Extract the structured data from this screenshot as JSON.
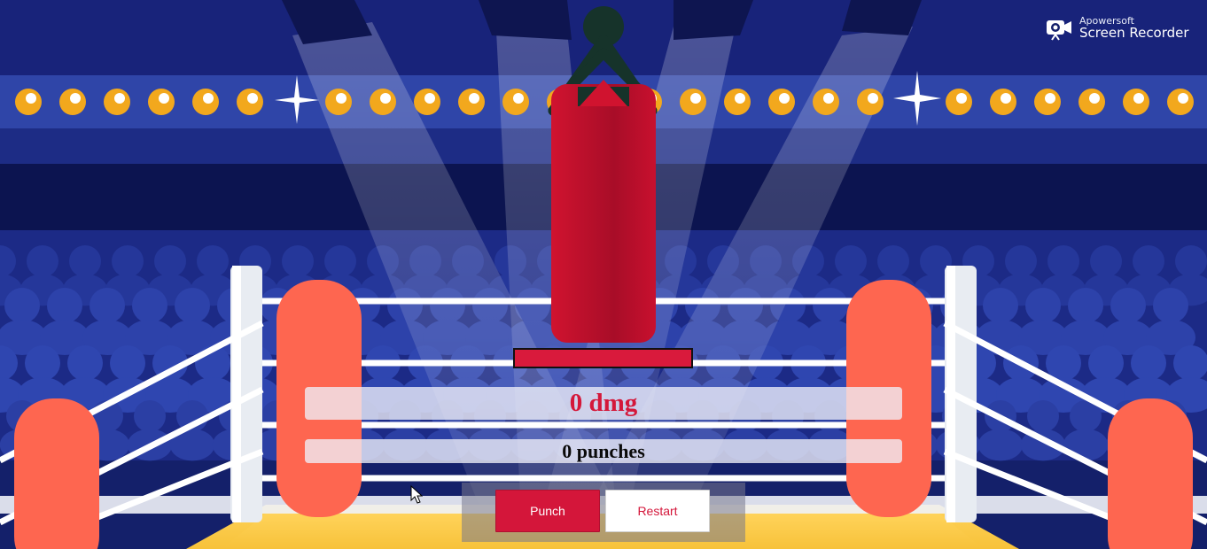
{
  "watermark": {
    "brand": "Apowersoft",
    "product": "Screen Recorder",
    "icon": "camera-icon"
  },
  "stats": {
    "damage": 0,
    "damage_label": "0 dmg",
    "punches": 0,
    "punches_label": "0 punches"
  },
  "bag": {
    "health_fraction": 1.0
  },
  "controls": {
    "punch_label": "Punch",
    "restart_label": "Restart"
  },
  "colors": {
    "accent": "#d4163a",
    "bag": "#c8102e",
    "corner_pad": "#fe6650",
    "arena_blue": "#1b2a80",
    "light_bulb": "#f2a81d"
  }
}
